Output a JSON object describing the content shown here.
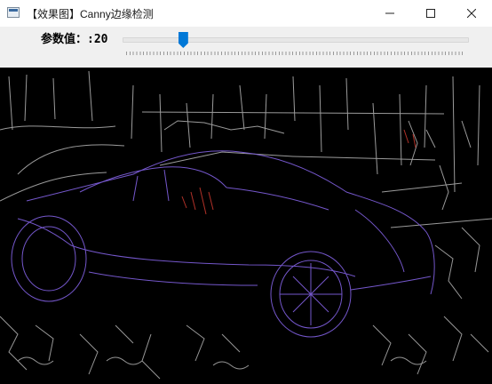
{
  "window": {
    "title": "【效果图】Canny边缘检测",
    "icon": "app-icon",
    "controls": [
      "minimize-icon",
      "maximize-icon",
      "close-icon"
    ]
  },
  "toolbar": {
    "param_label": "参数值：:20",
    "slider": {
      "value": 20,
      "min": 0,
      "max": 120,
      "accent": "#0078d7"
    }
  },
  "canvas": {
    "background": "#000000",
    "edge_colors": [
      "#6a5acd",
      "#8a6ee0",
      "#ffffff",
      "#c0392b"
    ]
  }
}
